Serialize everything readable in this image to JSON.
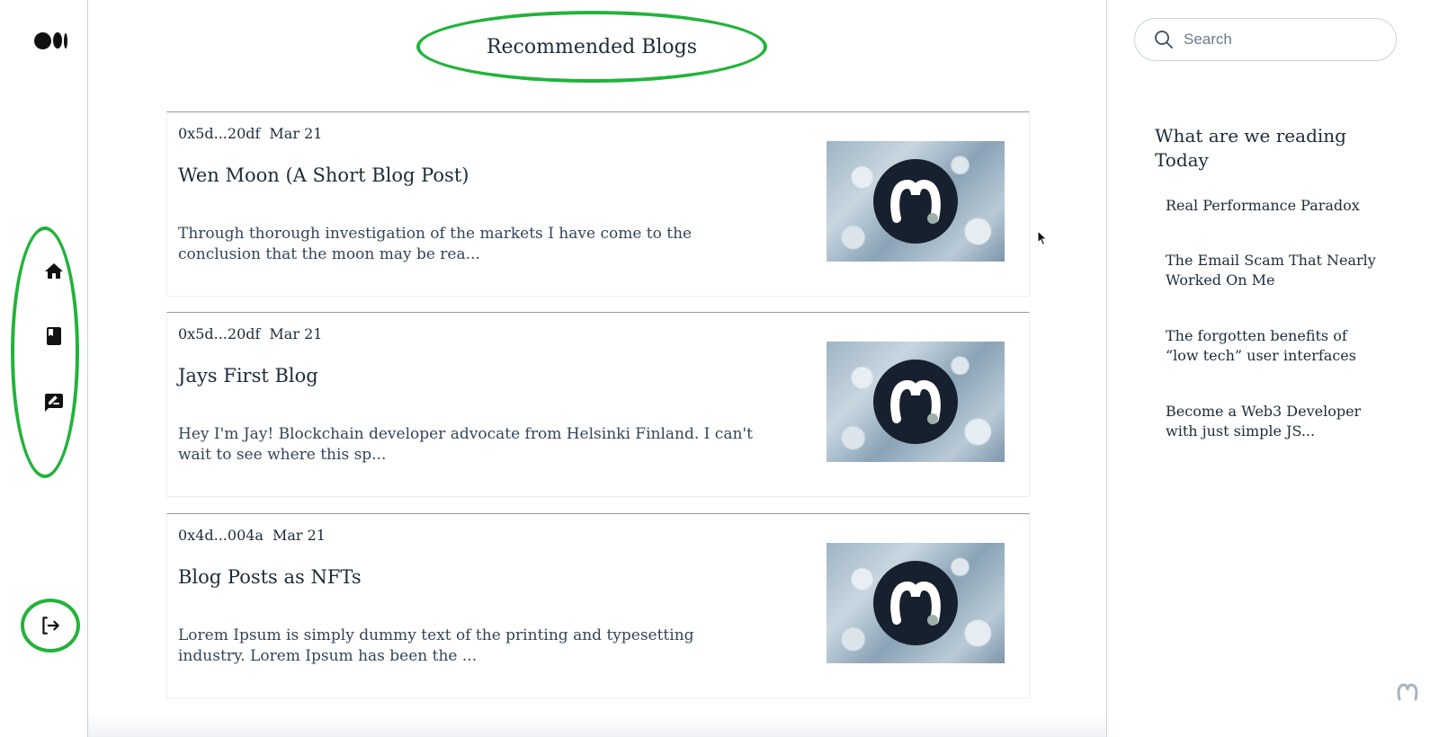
{
  "page": {
    "title": "Recommended Blogs"
  },
  "colors": {
    "accent_ring": "#22b33a",
    "text": "#1c2b3a",
    "divider": "#c9d2dc",
    "thumb_dark": "#17202e"
  },
  "rail": {
    "logo_icon": "medium-logo-icon",
    "nav": [
      {
        "icon": "home-icon"
      },
      {
        "icon": "book-icon"
      },
      {
        "icon": "rate-review-icon"
      }
    ],
    "logout_icon": "logout-icon"
  },
  "posts": [
    {
      "author": "0x5d...20df",
      "date": "Mar 21",
      "title": "Wen Moon (A Short Blog Post)",
      "excerpt": "Through thorough investigation of the markets I have come to the conclusion that the moon may be rea..."
    },
    {
      "author": "0x5d...20df",
      "date": "Mar 21",
      "title": "Jays First Blog",
      "excerpt": "Hey I'm Jay! Blockchain developer advocate from Helsinki Finland. I can't wait to see where this sp..."
    },
    {
      "author": "0x4d...004a",
      "date": "Mar 21",
      "title": "Blog Posts as NFTs",
      "excerpt": "Lorem Ipsum is simply dummy text of the printing and typesetting industry. Lorem Ipsum has been the ..."
    }
  ],
  "sidebar": {
    "search_placeholder": "Search",
    "heading": "What are we reading Today",
    "items": [
      "Real Performance Paradox",
      "The Email Scam That Nearly Worked On Me",
      "The forgotten benefits of “low tech” user interfaces",
      "Become a Web3 Developer with just simple JS..."
    ]
  }
}
